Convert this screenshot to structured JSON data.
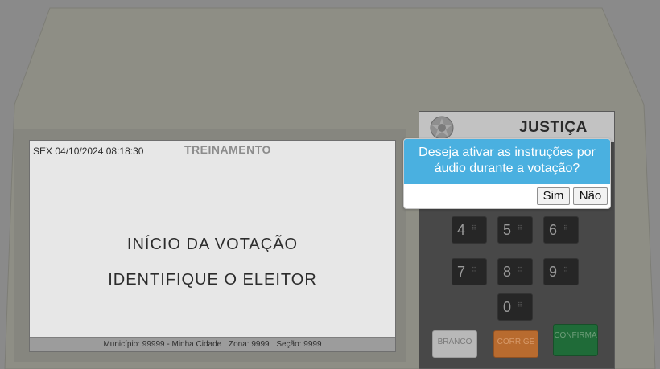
{
  "screen": {
    "datetime": "SEX 04/10/2024 08:18:30",
    "mode": "TREINAMENTO",
    "line1": "INÍCIO DA VOTAÇÃO",
    "line2": "IDENTIFIQUE O ELEITOR",
    "footer": {
      "municipio": "Município: 99999 - Minha Cidade",
      "zona": "Zona: 9999",
      "secao": "Seção: 9999"
    }
  },
  "panel": {
    "title": "JUSTIÇA",
    "keys": [
      "4",
      "5",
      "6",
      "7",
      "8",
      "9",
      "0"
    ],
    "branco_label": "BRANCO",
    "corrige_label": "CORRIGE",
    "confirma_label": "CONFIRMA"
  },
  "dialog": {
    "message": "Deseja ativar as instruções por áudio durante a votação?",
    "yes_label": "Sim",
    "no_label": "Não"
  },
  "colors": {
    "dialog_header": "#4ab0e0",
    "overlay": "#8a8a8a"
  }
}
